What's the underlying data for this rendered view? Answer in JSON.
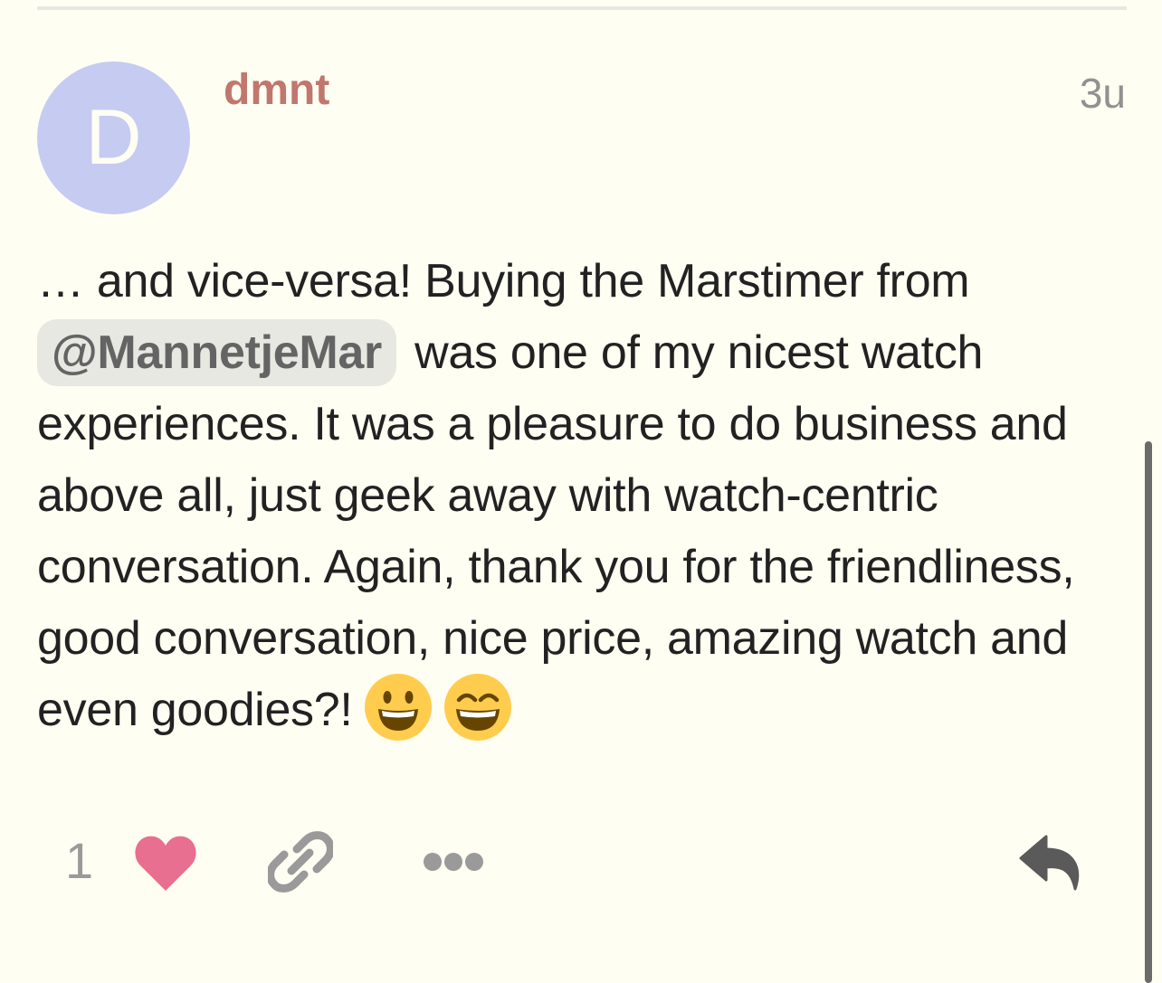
{
  "post": {
    "avatar_initial": "D",
    "username": "dmnt",
    "age": "3u",
    "body": {
      "text_before_mention": "… and vice-versa! Buying the Marstimer from ",
      "mention": "@MannetjeMar",
      "text_after_mention": " was one of my nicest watch experiences. It was a pleasure to do business and above all, just geek away with watch-centric conversation. Again, thank you for the friendliness, good conversation, nice price, amazing watch and even goodies?!",
      "emojis": [
        "smiley-emoji",
        "smile-emoji"
      ]
    },
    "actions": {
      "like_count": "1",
      "like_icon": "heart-icon",
      "link_icon": "link-icon",
      "more_icon": "ellipsis-icon",
      "reply_icon": "reply-icon"
    }
  },
  "colors": {
    "background": "#fffef3",
    "avatar": "#c6cbf1",
    "username": "#c0776e",
    "mention_bg": "#e8e8e2",
    "heart": "#e86f8f",
    "muted": "#9a9a9a"
  }
}
